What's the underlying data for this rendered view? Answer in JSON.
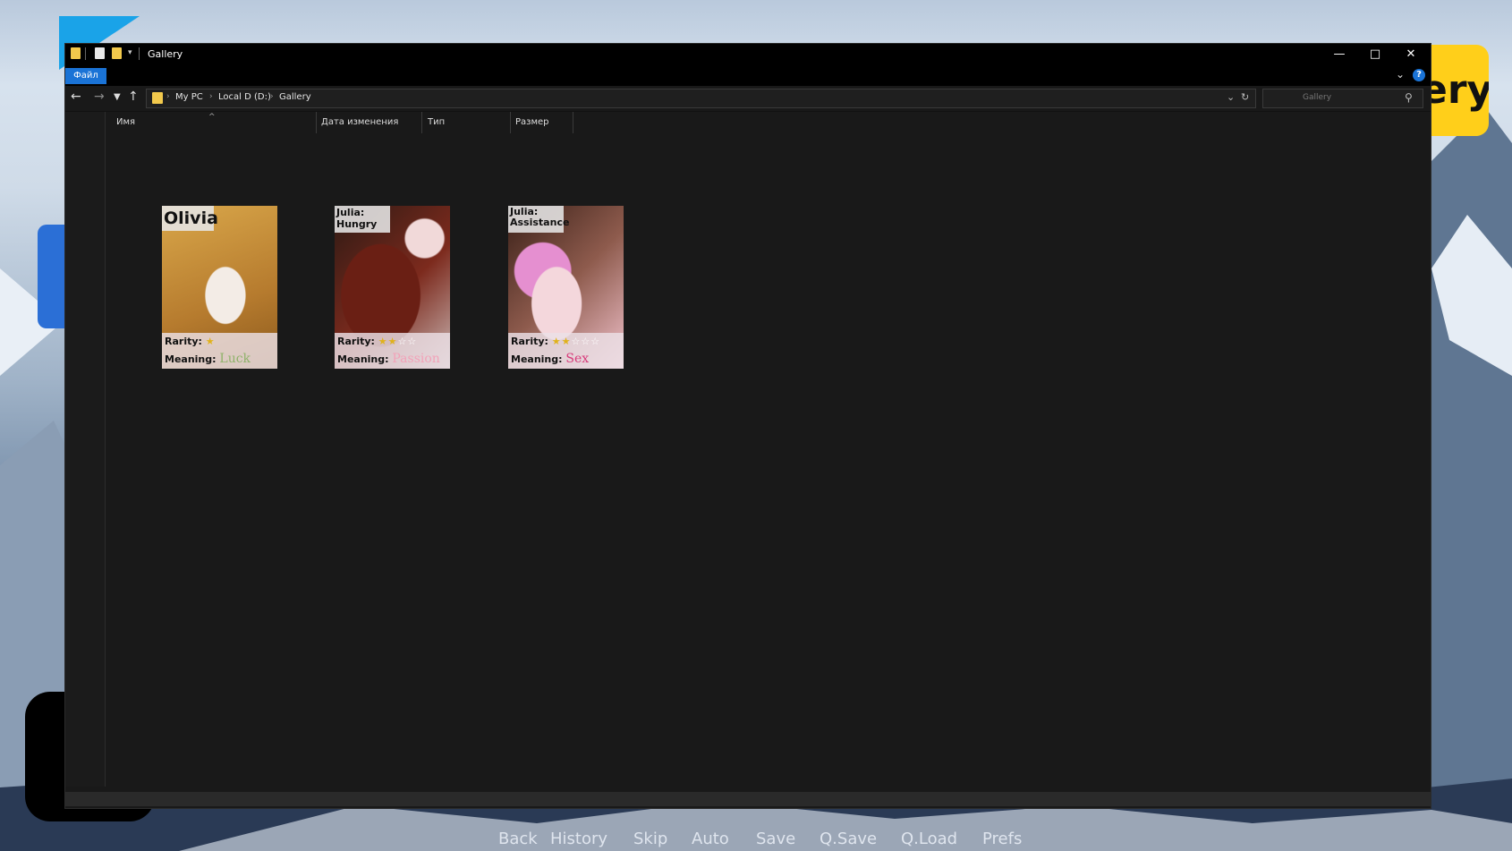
{
  "window": {
    "title": "Gallery",
    "file_tab": "Файл",
    "help_glyph": "?"
  },
  "address": {
    "segments": [
      "My PC",
      "Local D (D:)",
      "Gallery"
    ]
  },
  "search": {
    "placeholder": "Gallery"
  },
  "columns": [
    "Имя",
    "Дата изменения",
    "Тип",
    "Размер"
  ],
  "cards": [
    {
      "title": "Olivia",
      "rarity_label": "Rarity:",
      "stars": 1,
      "stars_total": 1,
      "meaning_label": "Meaning:",
      "meaning": "Luck"
    },
    {
      "title_line1": "Julia:",
      "title_line2": "Hungry",
      "rarity_label": "Rarity:",
      "stars": 2,
      "stars_total": 4,
      "meaning_label": "Meaning:",
      "meaning": "Passion"
    },
    {
      "title_line1": "Julia:",
      "title_line2": "Assistance",
      "rarity_label": "Rarity:",
      "stars": 2,
      "stars_total": 5,
      "meaning_label": "Meaning:",
      "meaning": "Sex"
    }
  ],
  "quick_menu": [
    "Back",
    "History",
    "Skip",
    "Auto",
    "Save",
    "Q.Save",
    "Q.Load",
    "Prefs"
  ],
  "desktop": {
    "right_logo_text": "ery"
  },
  "colors": {
    "accent": "#1a73d6",
    "folder": "#f2c94c",
    "window_bg": "#191919",
    "titlebar": "#000000"
  }
}
